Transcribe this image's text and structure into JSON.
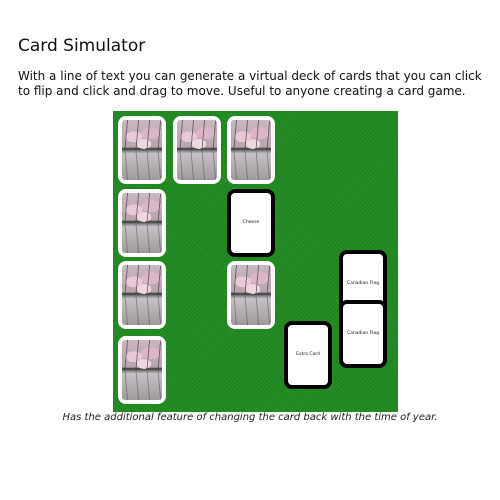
{
  "page": {
    "title": "Card Simulator",
    "description": "With a line of text you can generate a virtual deck of cards that you can click to flip and click and drag to move. Useful to anyone creating a card game.",
    "caption": "Has the additional feature of changing the card back with the time of year."
  },
  "table": {
    "color": "#1f8a1f",
    "card_back_image": "cherry-blossom-trees-reflection",
    "cards": [
      {
        "face": "back"
      },
      {
        "face": "back"
      },
      {
        "face": "back"
      },
      {
        "face": "back"
      },
      {
        "face": "front",
        "label": "Cheese"
      },
      {
        "face": "front",
        "label": "Canadian Flag"
      },
      {
        "face": "back"
      },
      {
        "face": "back"
      },
      {
        "face": "front",
        "label": "Canadian Flag"
      },
      {
        "face": "front",
        "label": "Extra Card"
      },
      {
        "face": "back"
      }
    ]
  }
}
